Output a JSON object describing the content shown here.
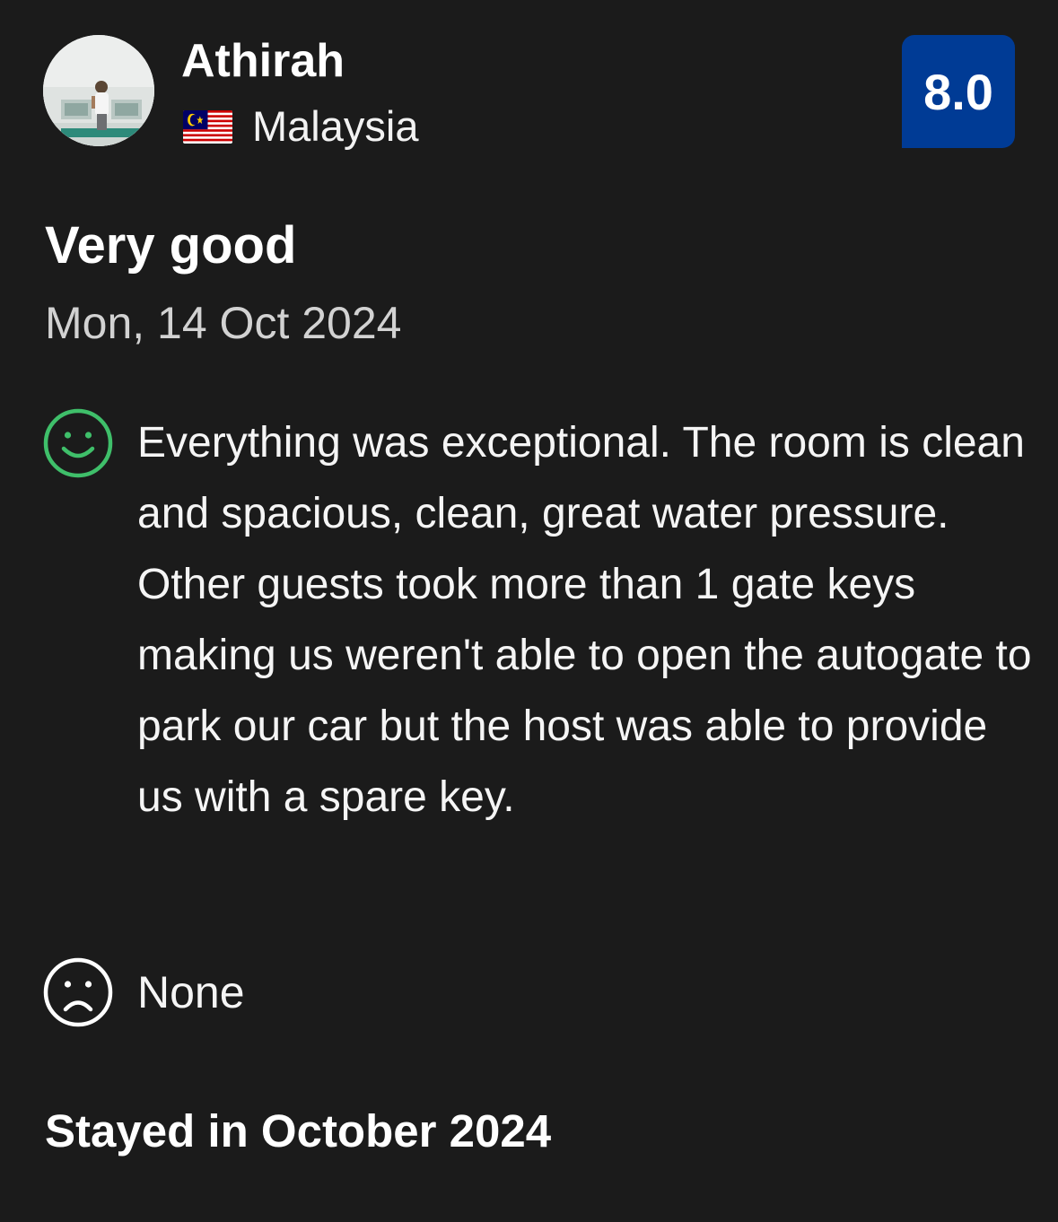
{
  "reviewer": {
    "name": "Athirah",
    "country": "Malaysia",
    "avatar_icon": "profile-photo",
    "flag_icon": "malaysia-flag-icon"
  },
  "score": {
    "value": "8.0",
    "badge_color": "#003b95"
  },
  "review": {
    "title": "Very good",
    "date": "Mon, 14 Oct 2024",
    "positive_icon": "smiley-face-icon",
    "positive_color": "#3fbf6a",
    "positive_text": "Everything was exceptional. The room is clean and spacious, clean, great water pressure. Other guests took more than 1 gate keys making us weren't able to open the autogate to park our car but the host was able to provide us with a spare key.",
    "negative_icon": "sad-face-icon",
    "negative_text": "None",
    "stay_info": "Stayed in October 2024"
  }
}
